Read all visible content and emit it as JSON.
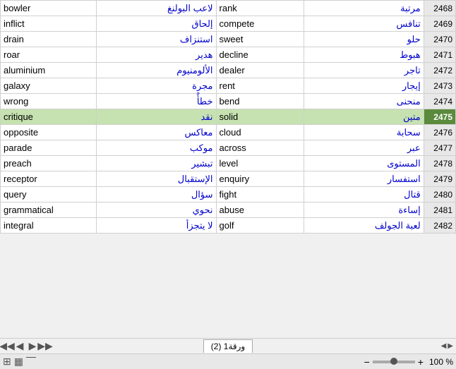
{
  "rows": [
    {
      "english": "bowler",
      "arabic_trans": "لاعب البولنغ",
      "english2": "rank",
      "arabic_trans2": "مرتبة",
      "num": "2468"
    },
    {
      "english": "inflict",
      "arabic_trans": "إلحاق",
      "english2": "compete",
      "arabic_trans2": "تنافس",
      "num": "2469"
    },
    {
      "english": "drain",
      "arabic_trans": "استنزاف",
      "english2": "sweet",
      "arabic_trans2": "حلو",
      "num": "2470"
    },
    {
      "english": "roar",
      "arabic_trans": "هدير",
      "english2": "decline",
      "arabic_trans2": "هبوط",
      "num": "2471"
    },
    {
      "english": "aluminium",
      "arabic_trans": "الألومنيوم",
      "english2": "dealer",
      "arabic_trans2": "تاجر",
      "num": "2472"
    },
    {
      "english": "galaxy",
      "arabic_trans": "مجرة",
      "english2": "rent",
      "arabic_trans2": "إيجار",
      "num": "2473"
    },
    {
      "english": "wrong",
      "arabic_trans": "خطأً",
      "english2": "bend",
      "arabic_trans2": "منحنى",
      "num": "2474"
    },
    {
      "english": "critique",
      "arabic_trans": "نقد",
      "english2": "solid",
      "arabic_trans2": "متين",
      "num": "2475",
      "highlight": true
    },
    {
      "english": "opposite",
      "arabic_trans": "معاكس",
      "english2": "cloud",
      "arabic_trans2": "سحابة",
      "num": "2476"
    },
    {
      "english": "parade",
      "arabic_trans": "موكب",
      "english2": "across",
      "arabic_trans2": "عبر",
      "num": "2477"
    },
    {
      "english": "preach",
      "arabic_trans": "تبشير",
      "english2": "level",
      "arabic_trans2": "المستوى",
      "num": "2478"
    },
    {
      "english": "receptor",
      "arabic_trans": "الإستقبال",
      "english2": "enquiry",
      "arabic_trans2": "استفسار",
      "num": "2479"
    },
    {
      "english": "query",
      "arabic_trans": "سؤال",
      "english2": "fight",
      "arabic_trans2": "قتال",
      "num": "2480"
    },
    {
      "english": "grammatical",
      "arabic_trans": "نحوي",
      "english2": "abuse",
      "arabic_trans2": "إساءة",
      "num": "2481"
    },
    {
      "english": "integral",
      "arabic_trans": "لا يتجزأ",
      "english2": "golf",
      "arabic_trans2": "لعبة الجولف",
      "num": "2482"
    }
  ],
  "sheet_tab": "ورقة1 (2)",
  "zoom_percent": "100 %",
  "nav_prev_prev": "◀◀",
  "nav_prev": "◀",
  "nav_next": "▶",
  "nav_next_next": "▶▶",
  "add_sheet_icon": "⊕",
  "icons": {
    "grid": "⊞",
    "table": "▦",
    "zoom_out": "−",
    "zoom_in": "+"
  }
}
